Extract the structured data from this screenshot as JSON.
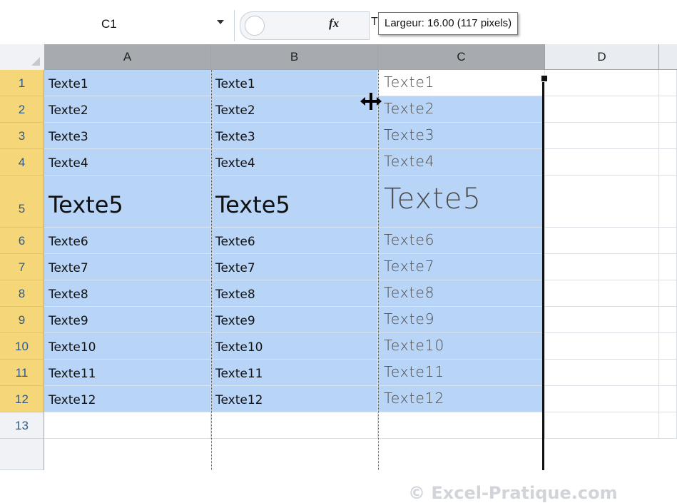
{
  "formula_bar": {
    "name_box": "C1",
    "fx_label": "fx",
    "cell_content": "T",
    "tooltip": "Largeur: 16.00 (117 pixels)"
  },
  "columns": [
    "A",
    "B",
    "C",
    "D"
  ],
  "rows": [
    {
      "n": "1",
      "a": "Texte1",
      "b": "Texte1",
      "c": "Texte1"
    },
    {
      "n": "2",
      "a": "Texte2",
      "b": "Texte2",
      "c": "Texte2"
    },
    {
      "n": "3",
      "a": "Texte3",
      "b": "Texte3",
      "c": "Texte3"
    },
    {
      "n": "4",
      "a": "Texte4",
      "b": "Texte4",
      "c": "Texte4"
    },
    {
      "n": "5",
      "a": "Texte5",
      "b": "Texte5",
      "c": "Texte5"
    },
    {
      "n": "6",
      "a": "Texte6",
      "b": "Texte6",
      "c": "Texte6"
    },
    {
      "n": "7",
      "a": "Texte7",
      "b": "Texte7",
      "c": "Texte7"
    },
    {
      "n": "8",
      "a": "Texte8",
      "b": "Texte8",
      "c": "Texte8"
    },
    {
      "n": "9",
      "a": "Texte9",
      "b": "Texte9",
      "c": "Texte9"
    },
    {
      "n": "10",
      "a": "Texte10",
      "b": "Texte10",
      "c": "Texte10"
    },
    {
      "n": "11",
      "a": "Texte11",
      "b": "Texte11",
      "c": "Texte11"
    },
    {
      "n": "12",
      "a": "Texte12",
      "b": "Texte12",
      "c": "Texte12"
    },
    {
      "n": "13",
      "a": "",
      "b": "",
      "c": ""
    }
  ],
  "watermark": "© Excel-Pratique.com",
  "colors": {
    "selection": "#b8d5f8",
    "row_header_selected": "#f5d77a",
    "column_header_selected": "#a7abaf"
  }
}
